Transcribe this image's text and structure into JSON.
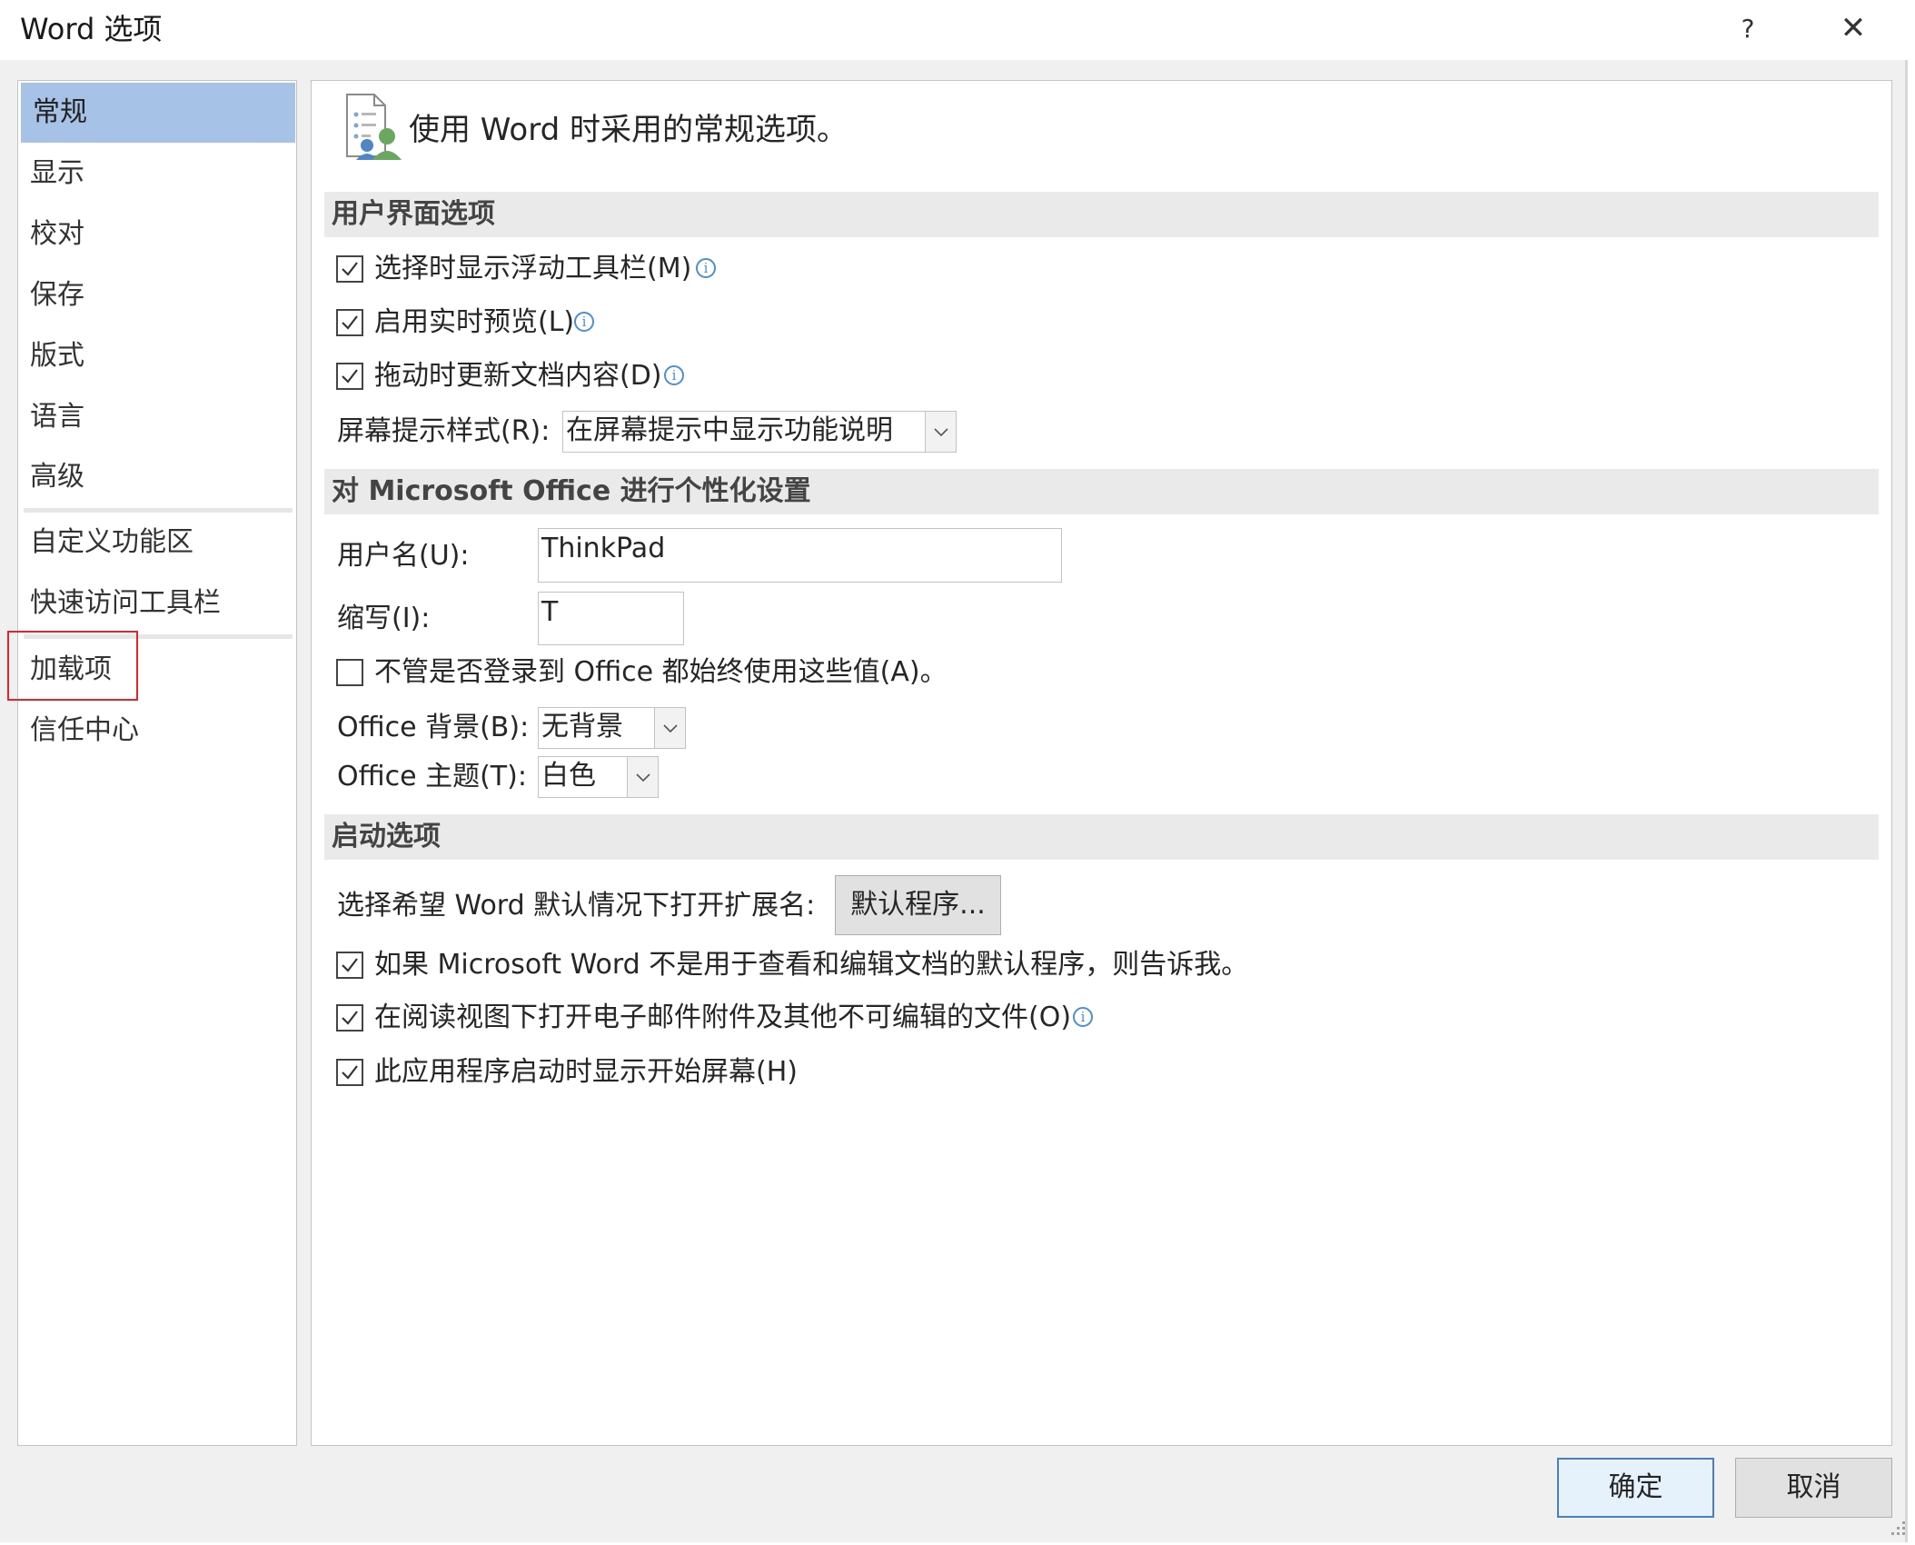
{
  "window": {
    "title": "Word 选项",
    "help_label": "?",
    "close_label": "✕"
  },
  "sidebar": {
    "items": [
      {
        "label": "常规",
        "selected": true
      },
      {
        "label": "显示"
      },
      {
        "label": "校对"
      },
      {
        "label": "保存"
      },
      {
        "label": "版式"
      },
      {
        "label": "语言"
      },
      {
        "label": "高级"
      },
      {
        "label": "自定义功能区"
      },
      {
        "label": "快速访问工具栏"
      },
      {
        "label": "加载项",
        "highlighted": true
      },
      {
        "label": "信任中心"
      }
    ]
  },
  "main": {
    "header": "使用 Word 时采用的常规选项。",
    "sections": {
      "ui": {
        "title": "用户界面选项",
        "mini_toolbar": {
          "label": "选择时显示浮动工具栏(M)",
          "checked": true
        },
        "live_preview": {
          "label": "启用实时预览(L)",
          "checked": true
        },
        "update_drag": {
          "label": "拖动时更新文档内容(D)",
          "checked": true
        },
        "screentip_label": "屏幕提示样式(R):",
        "screentip_value": "在屏幕提示中显示功能说明"
      },
      "personalize": {
        "title": "对 Microsoft Office 进行个性化设置",
        "username_label": "用户名(U):",
        "username_value": "ThinkPad",
        "initials_label": "缩写(I):",
        "initials_value": "T",
        "always_use": {
          "label": "不管是否登录到 Office 都始终使用这些值(A)。",
          "checked": false
        },
        "background_label": "Office 背景(B):",
        "background_value": "无背景",
        "theme_label": "Office 主题(T):",
        "theme_value": "白色"
      },
      "startup": {
        "title": "启动选项",
        "default_ext_label": "选择希望 Word 默认情况下打开扩展名:",
        "default_programs_button": "默认程序...",
        "tell_me_default": {
          "label": "如果 Microsoft Word 不是用于查看和编辑文档的默认程序，则告诉我。",
          "checked": true
        },
        "reading_view": {
          "label": "在阅读视图下打开电子邮件附件及其他不可编辑的文件(O)",
          "checked": true
        },
        "start_screen": {
          "label": "此应用程序启动时显示开始屏幕(H)",
          "checked": true
        }
      }
    }
  },
  "footer": {
    "ok_label": "确定",
    "cancel_label": "取消"
  },
  "colors": {
    "selected_nav": "#a7c2e7",
    "highlight_box": "#e0262c",
    "section_bar": "#eaeaea",
    "primary_border": "#4a7fbf"
  }
}
